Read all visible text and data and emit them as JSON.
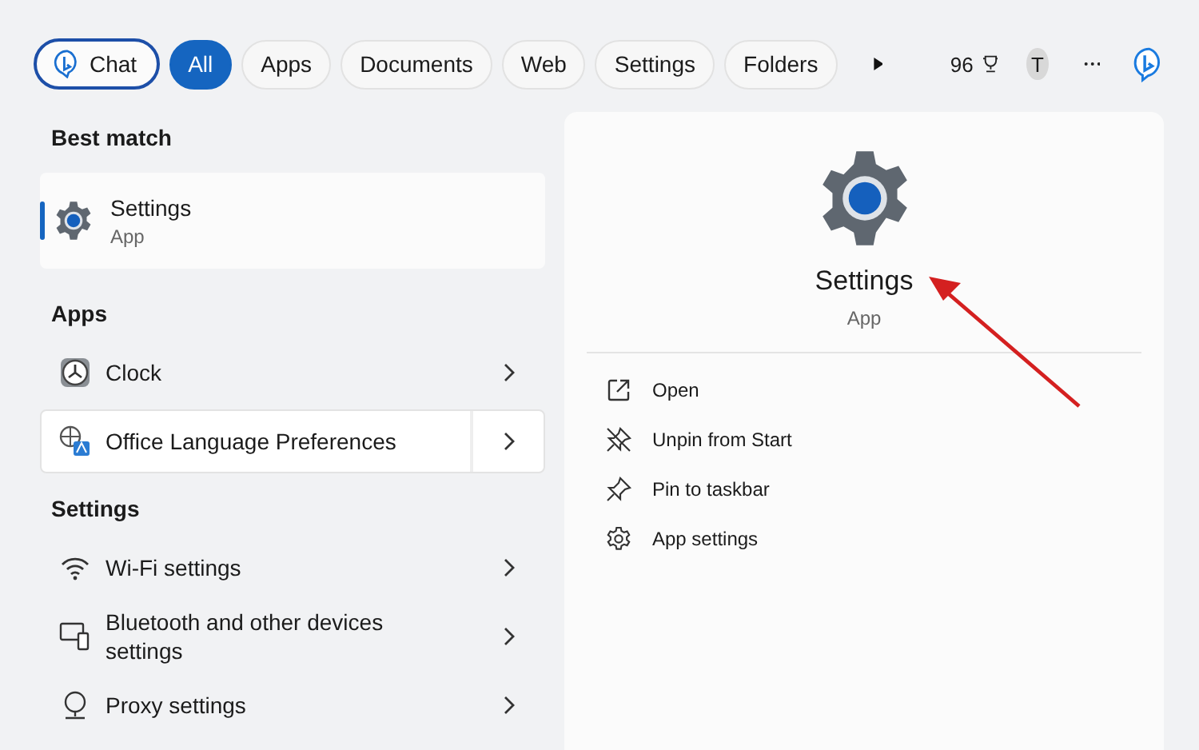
{
  "top_bar": {
    "chat": "Chat",
    "filters": [
      {
        "label": "All",
        "selected": true
      },
      {
        "label": "Apps",
        "selected": false
      },
      {
        "label": "Documents",
        "selected": false
      },
      {
        "label": "Web",
        "selected": false
      },
      {
        "label": "Settings",
        "selected": false
      },
      {
        "label": "Folders",
        "selected": false
      }
    ],
    "points": "96",
    "avatar": "T"
  },
  "best_match": {
    "heading": "Best match",
    "title": "Settings",
    "subtitle": "App",
    "kind": "gear",
    "selected": true
  },
  "sections": [
    {
      "heading": "Apps",
      "items": [
        {
          "title": "Clock",
          "kind": "clock",
          "hovered": false
        },
        {
          "title": "Office Language Preferences",
          "kind": "language",
          "hovered": true
        }
      ]
    },
    {
      "heading": "Settings",
      "items": [
        {
          "title": "Wi-Fi settings",
          "kind": "wifi",
          "hovered": false
        },
        {
          "title": "Bluetooth and other devices settings",
          "kind": "devices",
          "hovered": false
        },
        {
          "title": "Proxy settings",
          "kind": "proxy",
          "hovered": false
        }
      ]
    }
  ],
  "detail": {
    "title": "Settings",
    "subtitle": "App",
    "actions": [
      {
        "label": "Open",
        "kind": "open"
      },
      {
        "label": "Unpin from Start",
        "kind": "unpin"
      },
      {
        "label": "Pin to taskbar",
        "kind": "pin"
      },
      {
        "label": "App settings",
        "kind": "gear"
      }
    ]
  }
}
